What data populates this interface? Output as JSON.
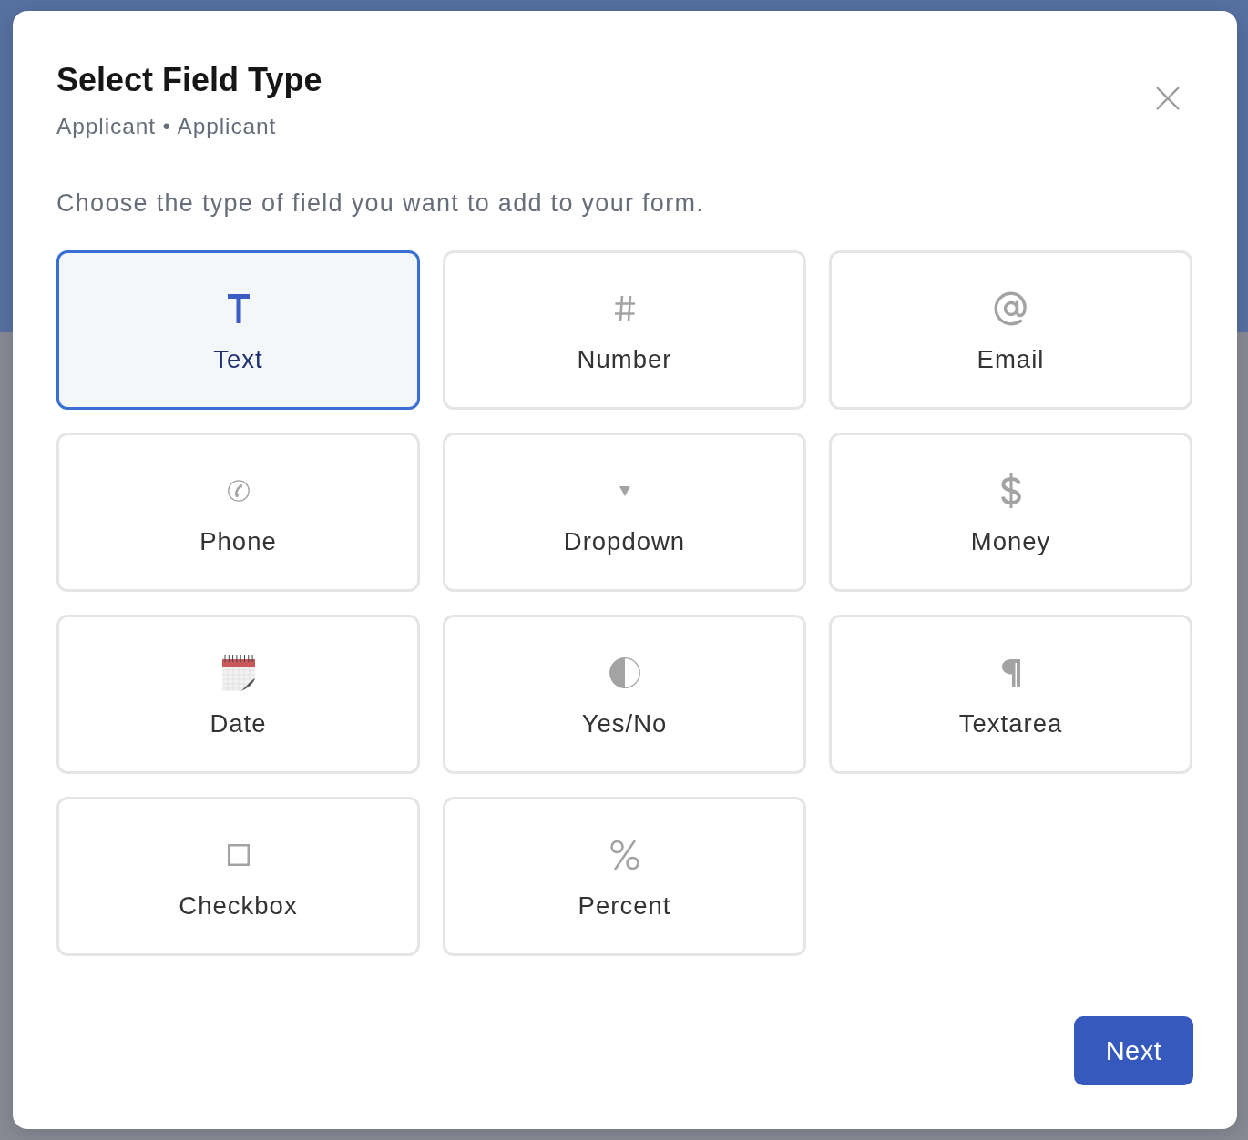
{
  "dialog": {
    "title": "Select Field Type",
    "subtitle": "Applicant • Applicant",
    "description": "Choose the type of field you want to add to your form.",
    "field_types": [
      {
        "label": "Text",
        "kind": "letter",
        "selected": true
      },
      {
        "label": "Number",
        "kind": "hash",
        "selected": false
      },
      {
        "label": "Email",
        "kind": "at",
        "selected": false
      },
      {
        "label": "Phone",
        "kind": "phone",
        "selected": false
      },
      {
        "label": "Dropdown",
        "kind": "triangle",
        "selected": false
      },
      {
        "label": "Money",
        "kind": "dollar",
        "selected": false
      },
      {
        "label": "Date",
        "kind": "calendar",
        "selected": false
      },
      {
        "label": "Yes/No",
        "kind": "halfcircle",
        "selected": false
      },
      {
        "label": "Textarea",
        "kind": "pilcrow",
        "selected": false
      },
      {
        "label": "Checkbox",
        "kind": "square",
        "selected": false
      },
      {
        "label": "Percent",
        "kind": "percent",
        "selected": false
      }
    ],
    "buttons": [
      {
        "label": "Next"
      }
    ]
  }
}
